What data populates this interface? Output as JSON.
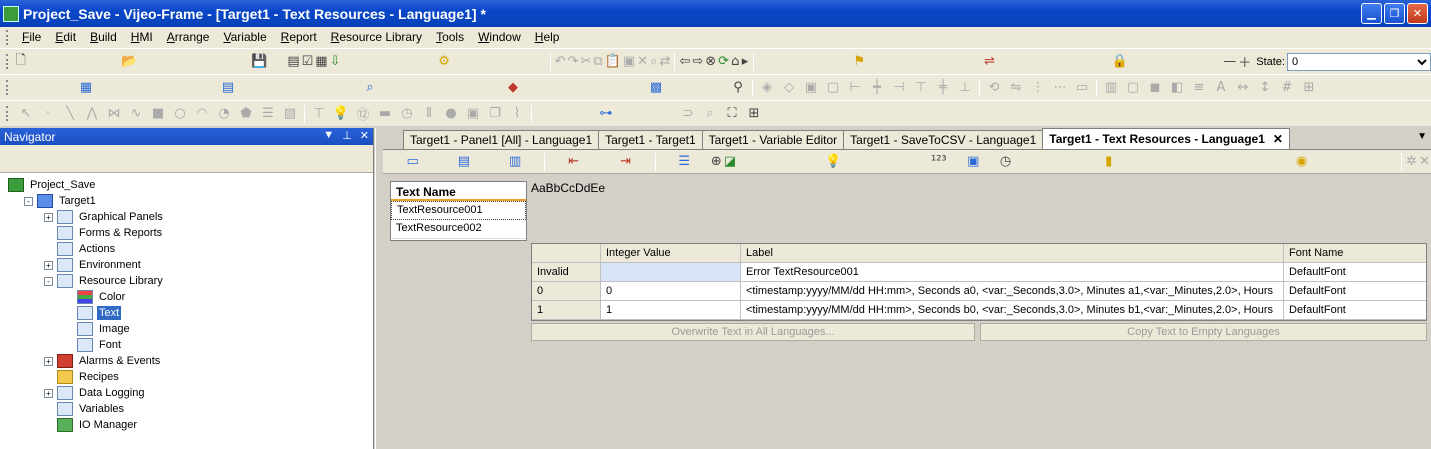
{
  "window": {
    "title": "Project_Save - Vijeo-Frame - [Target1 - Text Resources - Language1] *"
  },
  "menu": [
    "File",
    "Edit",
    "Build",
    "HMI",
    "Arrange",
    "Variable",
    "Report",
    "Resource Library",
    "Tools",
    "Window",
    "Help"
  ],
  "toolbar": {
    "state_label": "State:",
    "state_value": "0"
  },
  "navigator": {
    "title": "Navigator",
    "tree": [
      {
        "label": "Project_Save",
        "level": 0,
        "icon": "project-icon"
      },
      {
        "label": "Target1",
        "level": 1,
        "icon": "target-icon",
        "expander": "-"
      },
      {
        "label": "Graphical Panels",
        "level": 2,
        "icon": "panels-icon",
        "expander": "+"
      },
      {
        "label": "Forms & Reports",
        "level": 2,
        "icon": "forms-icon"
      },
      {
        "label": "Actions",
        "level": 2,
        "icon": "actions-icon"
      },
      {
        "label": "Environment",
        "level": 2,
        "icon": "environment-icon",
        "expander": "+"
      },
      {
        "label": "Resource Library",
        "level": 2,
        "icon": "resource-library-icon",
        "expander": "-"
      },
      {
        "label": "Color",
        "level": 3,
        "icon": "color-icon"
      },
      {
        "label": "Text",
        "level": 3,
        "icon": "text-icon",
        "selected": true
      },
      {
        "label": "Image",
        "level": 3,
        "icon": "image-icon"
      },
      {
        "label": "Font",
        "level": 3,
        "icon": "font-icon"
      },
      {
        "label": "Alarms & Events",
        "level": 2,
        "icon": "alarms-icon",
        "expander": "+"
      },
      {
        "label": "Recipes",
        "level": 2,
        "icon": "recipes-icon"
      },
      {
        "label": "Data Logging",
        "level": 2,
        "icon": "data-logging-icon",
        "expander": "+"
      },
      {
        "label": "Variables",
        "level": 2,
        "icon": "variables-icon"
      },
      {
        "label": "IO Manager",
        "level": 2,
        "icon": "io-manager-icon"
      }
    ]
  },
  "tabs": [
    {
      "label": "Target1 - Panel1 [All] - Language1"
    },
    {
      "label": "Target1 - Target1"
    },
    {
      "label": "Target1 - Variable Editor"
    },
    {
      "label": "Target1 - SaveToCSV - Language1"
    },
    {
      "label": "Target1 - Text Resources - Language1",
      "active": true
    }
  ],
  "text_resources": {
    "list_header": "Text Name",
    "names": [
      "TextResource001",
      "TextResource002"
    ],
    "preview": "AaBbCcDdEe",
    "columns": [
      "",
      "Integer Value",
      "Label",
      "Font Name"
    ],
    "rows": [
      [
        "Invalid",
        "",
        "Error TextResource001",
        "DefaultFont"
      ],
      [
        "0",
        "0",
        "<timestamp:yyyy/MM/dd HH:mm>, Seconds a0, <var:_Seconds,3.0>, Minutes a1,<var:_Minutes,2.0>, Hours",
        "DefaultFont"
      ],
      [
        "1",
        "1",
        "<timestamp:yyyy/MM/dd HH:mm>, Seconds b0, <var:_Seconds,3.0>, Minutes b1,<var:_Minutes,2.0>, Hours",
        "DefaultFont"
      ]
    ],
    "overwrite_button": "Overwrite Text in All Languages...",
    "copy_button": "Copy Text to Empty Languages"
  }
}
